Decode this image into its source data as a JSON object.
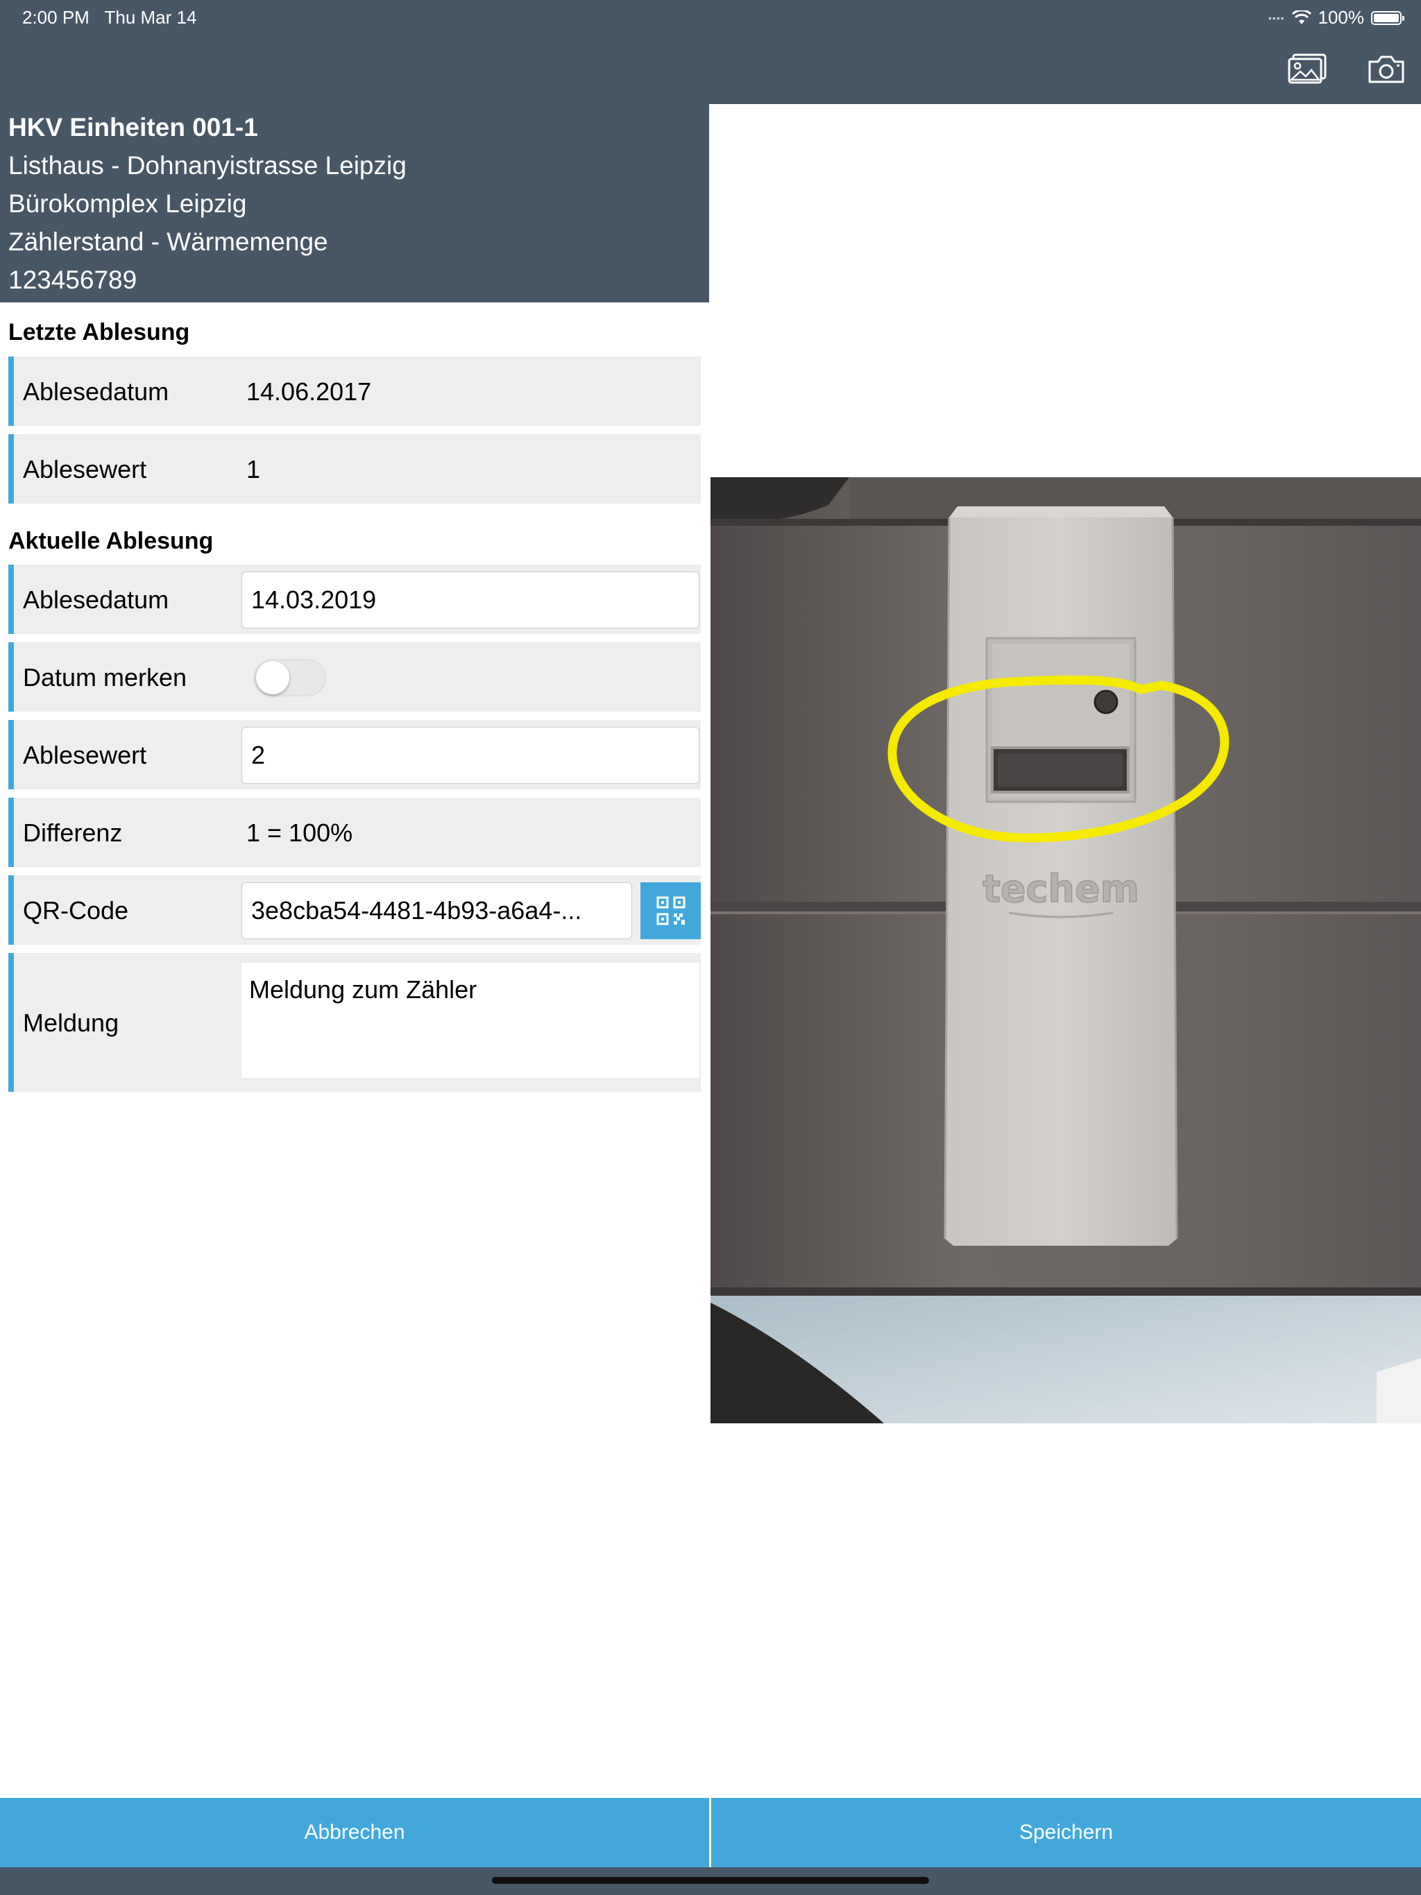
{
  "status_bar": {
    "time": "2:00 PM",
    "date": "Thu Mar 14",
    "battery": "100%",
    "icons": [
      "signal-icon",
      "wifi-icon",
      "battery-icon"
    ]
  },
  "navbar": {
    "icons": [
      "gallery-icon",
      "camera-icon"
    ]
  },
  "header": {
    "title": "HKV Einheiten 001-1",
    "property": "Listhaus - Dohnanyistrasse Leipzig",
    "building": "Bürokomplex Leipzig",
    "meter_type": "Zählerstand - Wärmemenge",
    "meter_number": "123456789"
  },
  "last_reading": {
    "section_title": "Letzte Ablesung",
    "date_label": "Ablesedatum",
    "date_value": "14.06.2017",
    "value_label": "Ablesewert",
    "value": "1"
  },
  "current_reading": {
    "section_title": "Aktuelle Ablesung",
    "date_label": "Ablesedatum",
    "date_value": "14.03.2019",
    "remember_label": "Datum merken",
    "remember_on": false,
    "value_label": "Ablesewert",
    "value": "2",
    "difference_label": "Differenz",
    "difference_value": "1 = 100%",
    "qr_label": "QR-Code",
    "qr_value": "3e8cba54-4481-4b93-a6a4-...",
    "message_label": "Meldung",
    "message_value": "Meldung zum Zähler"
  },
  "photo": {
    "brand_text": "techem",
    "highlight_color": "#f5ea00"
  },
  "actions": {
    "cancel_label": "Abbrechen",
    "save_label": "Speichern"
  },
  "colors": {
    "header_bg": "#485766",
    "accent": "#42a8dc",
    "row_bg": "#eeeeee"
  }
}
